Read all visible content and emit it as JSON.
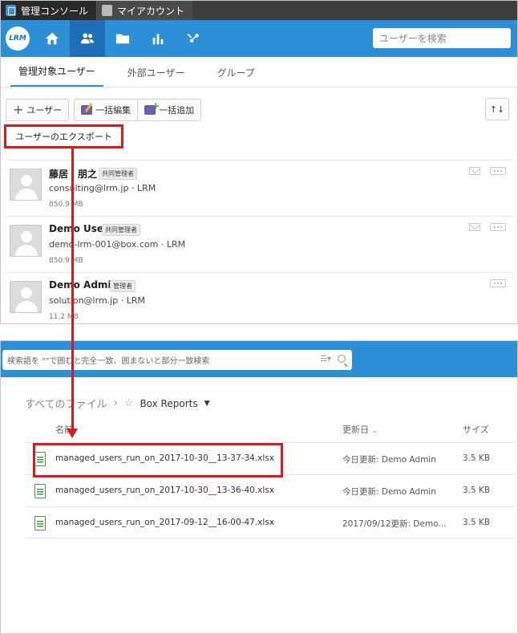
{
  "window_tabs": [
    {
      "label": "管理コンソール",
      "active": true
    },
    {
      "label": "マイアカウント",
      "active": false
    }
  ],
  "navbar": {
    "logo_text": "LRM",
    "icons": [
      "home-icon",
      "users-icon",
      "folder-icon",
      "bar-chart-icon",
      "apps-icon"
    ],
    "search_placeholder": "ユーザーを検索"
  },
  "subtabs": [
    "管理対象ユーザー",
    "外部ユーザー",
    "グループ"
  ],
  "toolbar": {
    "add_user": "ユーザー",
    "bulk_edit": "一括編集",
    "bulk_add": "一括追加",
    "sort_glyph": "↑↓",
    "export_users": "ユーザーのエクスポート"
  },
  "users": [
    {
      "name": "藤居　朋之",
      "role": "共同管理者",
      "email": "consulting@lrm.jp",
      "group": "LRM",
      "size": "850.9 MB"
    },
    {
      "name": "Demo User",
      "role": "共同管理者",
      "email": "demo-lrm-001@box.com",
      "group": "LRM",
      "size": "850.9 MB"
    },
    {
      "name": "Demo Admin",
      "role": "管理者",
      "email": "solution@lrm.jp",
      "group": "LRM",
      "size": "11.2 MB"
    }
  ],
  "box": {
    "search_placeholder": "検索語を \"\"で囲むと完全一致、囲まないと部分一致検索",
    "breadcrumb_root": "すべてのファイル",
    "breadcrumb_current": "Box Reports",
    "columns": {
      "name": "名前",
      "updated": "更新日",
      "size": "サイズ"
    },
    "files": [
      {
        "name": "managed_users_run_on_2017-10-30__13-37-34.xlsx",
        "updated": "今日更新: Demo Admin",
        "size": "3.5 KB"
      },
      {
        "name": "managed_users_run_on_2017-10-30__13-36-40.xlsx",
        "updated": "今日更新: Demo Admin",
        "size": "3.5 KB"
      },
      {
        "name": "managed_users_run_on_2017-09-12__16-00-47.xlsx",
        "updated": "2017/09/12更新: Demo...",
        "size": "3.5 KB"
      }
    ]
  },
  "colors": {
    "accent_blue": "#2d8fd5",
    "highlight_red": "#d71920"
  }
}
